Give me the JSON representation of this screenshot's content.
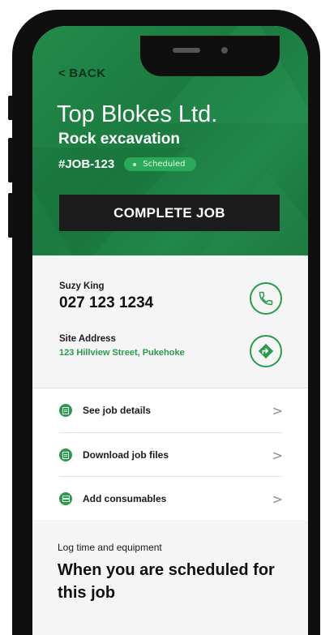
{
  "header": {
    "back_label": "BACK",
    "company": "Top Blokes Ltd.",
    "service": "Rock excavation",
    "job_number": "#JOB-123",
    "status": "Scheduled",
    "complete_label": "COMPLETE JOB"
  },
  "contact": {
    "name": "Suzy King",
    "phone": "027 123 1234",
    "call_icon": "phone-icon",
    "address_label": "Site Address",
    "address": "123 Hillview Street, Pukehoke",
    "directions_icon": "directions-icon"
  },
  "menu": {
    "items": [
      {
        "label": "See job details",
        "icon": "document-icon"
      },
      {
        "label": "Download job files",
        "icon": "document-icon"
      },
      {
        "label": "Add consumables",
        "icon": "list-icon"
      }
    ]
  },
  "log": {
    "label": "Log time and equipment",
    "title": "When you are scheduled for this job"
  },
  "colors": {
    "brand_green": "#238a4a",
    "accent_green": "#2a9a4e",
    "button_dark": "#1c1c1c"
  }
}
